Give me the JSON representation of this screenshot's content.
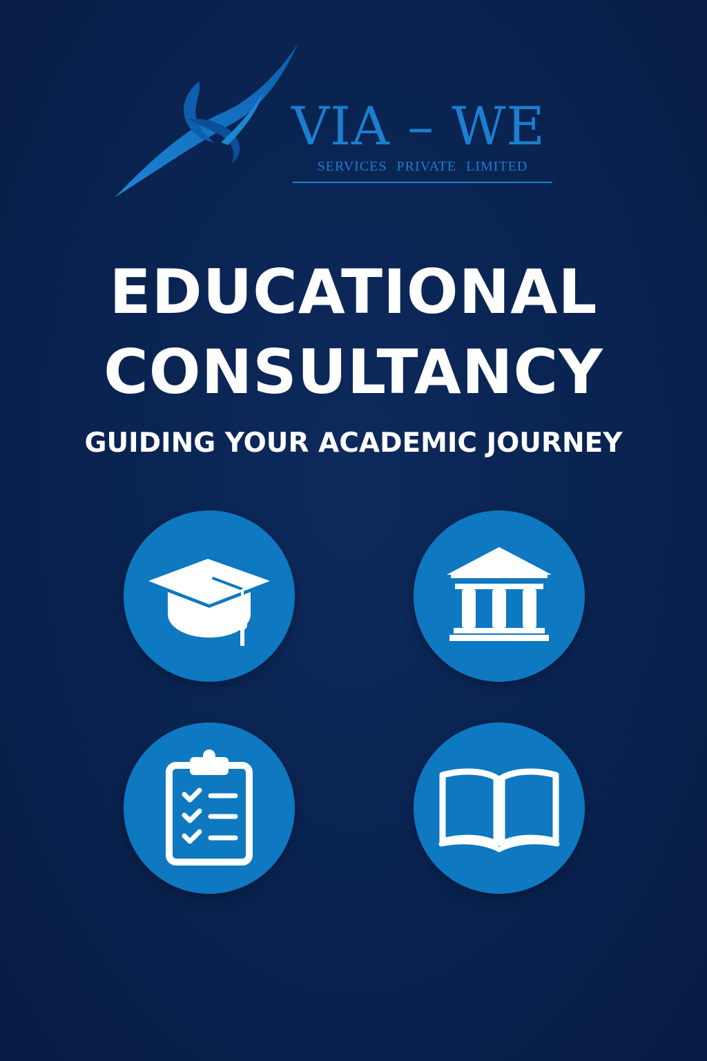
{
  "brand": {
    "name": "VIA – WE",
    "tagline": "SERVICES PRIVATE LIMITED",
    "accent_color": "#1b7fd0"
  },
  "headline": {
    "line1": "EDUCATIONAL",
    "line2": "CONSULTANCY"
  },
  "subheadline": "GUIDING YOUR ACADEMIC JOURNEY",
  "colors": {
    "background": "#0a2452",
    "circle": "#0e78c1",
    "text": "#ffffff"
  },
  "services": [
    {
      "icon": "graduation-cap-icon"
    },
    {
      "icon": "institution-building-icon"
    },
    {
      "icon": "clipboard-checklist-icon"
    },
    {
      "icon": "open-book-icon"
    }
  ]
}
